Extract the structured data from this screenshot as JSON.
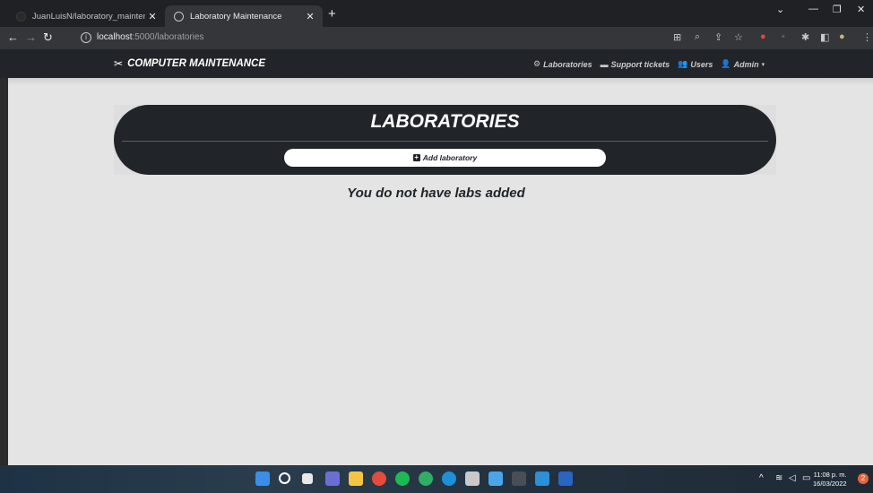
{
  "browser": {
    "tabs": [
      {
        "label": "JuanLuisN/laboratory_maintenan"
      },
      {
        "label": "Laboratory Maintenance"
      }
    ],
    "url_host": "localhost",
    "url_path": ":5000/laboratories"
  },
  "navbar": {
    "brand": "COMPUTER MAINTENANCE",
    "links": [
      {
        "label": "Laboratories",
        "icon": "computer-icon"
      },
      {
        "label": "Support tickets",
        "icon": "ticket-icon"
      },
      {
        "label": "Users",
        "icon": "users-icon"
      },
      {
        "label": "Admin",
        "icon": "user-icon"
      }
    ]
  },
  "main": {
    "title": "LABORATORIES",
    "add_button": "Add laboratory",
    "empty_message": "You do not have labs added"
  },
  "taskbar": {
    "time": "11:08 p. m.",
    "date": "16/03/2022",
    "notifications": "2"
  },
  "colors": {
    "navbar_bg": "#212529",
    "page_bg": "#e4e4e4",
    "card_bg": "#212529"
  }
}
